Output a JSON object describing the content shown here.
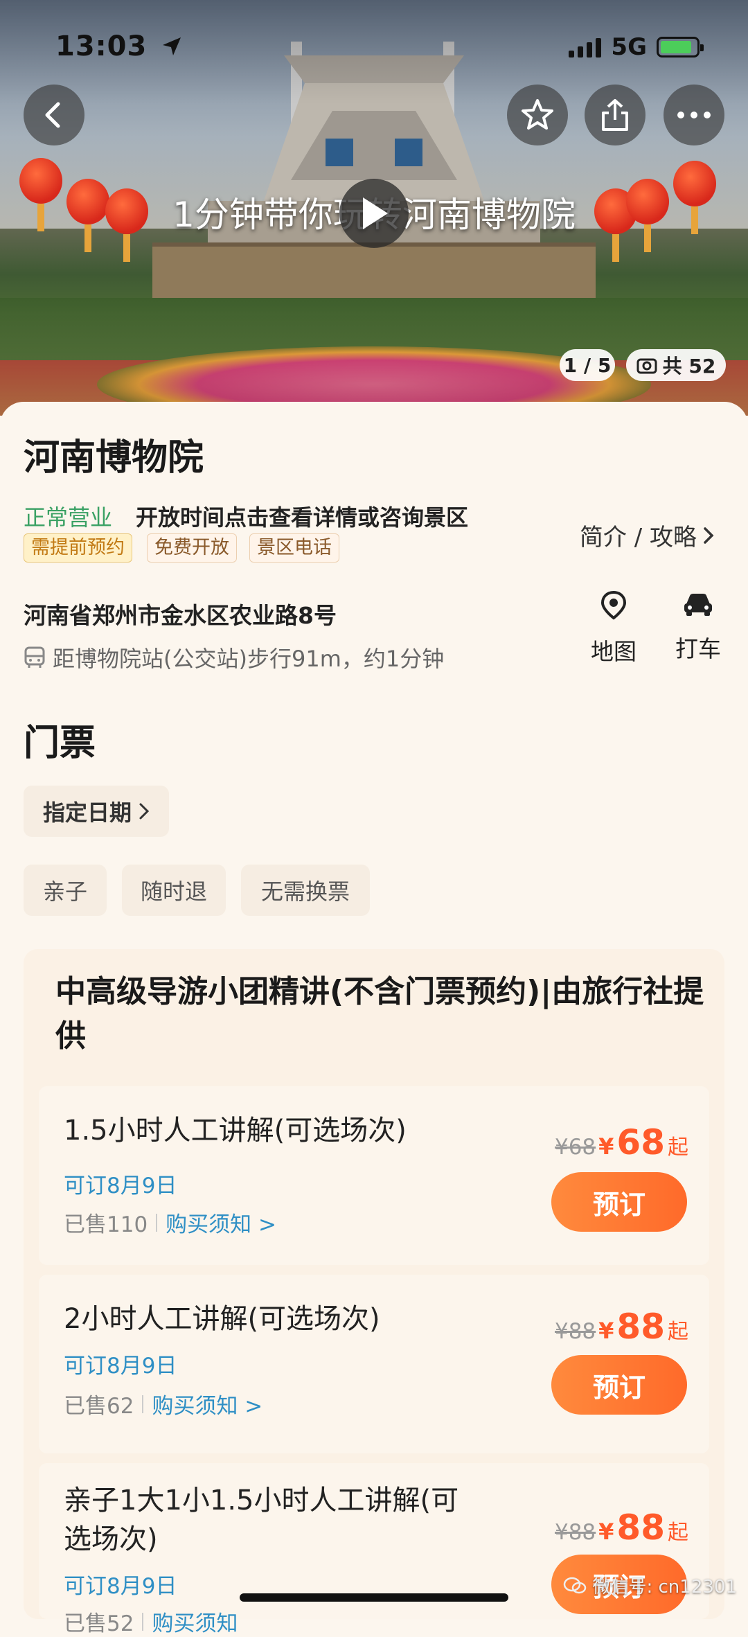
{
  "status_bar": {
    "time": "13:03",
    "network": "5G"
  },
  "hero": {
    "video_title": "1分钟带你玩转河南博物院",
    "carousel_counter": "1 / 5",
    "photo_count": "共 52"
  },
  "attraction": {
    "name": "河南博物院",
    "open_status": "正常营业",
    "open_hours_hint": "开放时间点击查看详情或咨询景区",
    "tags": [
      "需提前预约",
      "免费开放",
      "景区电话"
    ],
    "intro_link": "简介 / 攻略",
    "address": "河南省郑州市金水区农业路8号",
    "distance": "距博物院站(公交站)步行91m，约1分钟",
    "actions": {
      "map": "地图",
      "taxi": "打车"
    }
  },
  "tickets": {
    "section_title": "门票",
    "date_filter": "指定日期",
    "filters": [
      "亲子",
      "随时退",
      "无需换票"
    ],
    "package_title": "中高级导游小团精讲(不含门票预约)|由旅行社提供",
    "items": [
      {
        "name": "1.5小时人工讲解(可选场次)",
        "available": "可订8月9日",
        "sold": "已售110",
        "notice": "购买须知 >",
        "original_price": "¥68",
        "price_symbol": "¥",
        "price": "68",
        "suffix": "起",
        "button": "预订"
      },
      {
        "name": "2小时人工讲解(可选场次)",
        "available": "可订8月9日",
        "sold": "已售62",
        "notice": "购买须知 >",
        "original_price": "¥88",
        "price_symbol": "¥",
        "price": "88",
        "suffix": "起",
        "button": "预订"
      },
      {
        "name": "亲子1大1小1.5小时人工讲解(可选场次)",
        "available": "可订8月9日",
        "sold": "已售52",
        "notice": "购买须知",
        "original_price": "¥88",
        "price_symbol": "¥",
        "price": "88",
        "suffix": "起",
        "button": "预订"
      }
    ]
  },
  "watermark": "微信号: cn12301"
}
